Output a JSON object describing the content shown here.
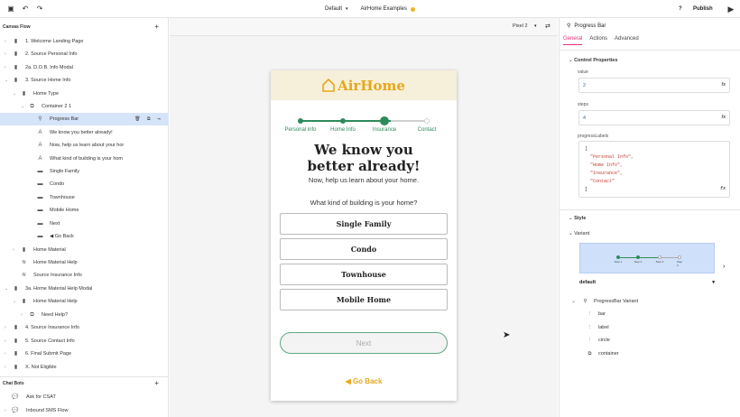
{
  "topbar": {
    "env": "Default",
    "project": "AirHome Examples",
    "help": "?",
    "publish": "Publish"
  },
  "left": {
    "canvas_title": "Canvas Flow",
    "canvas_items": [
      {
        "label": "1. Welcome Landing Page"
      },
      {
        "label": "2. Source Personal Info"
      },
      {
        "label": "2a. D.O.B. Info Modal"
      },
      {
        "label": "3. Source Home Info"
      },
      {
        "label": "Home Type"
      },
      {
        "label": "Container 2 1"
      },
      {
        "label": "Progress Bar"
      },
      {
        "label": "We know you better already!"
      },
      {
        "label": "Now, help us learn about your hor"
      },
      {
        "label": "What kind of building is your hom"
      },
      {
        "label": "Single Family"
      },
      {
        "label": "Condo"
      },
      {
        "label": "Townhouse"
      },
      {
        "label": "Mobile Home"
      },
      {
        "label": "Next"
      },
      {
        "label": "Go Back"
      },
      {
        "label": "Home Material"
      },
      {
        "label": "Home Material Help"
      },
      {
        "label": "Source Insurance Info"
      },
      {
        "label": "3a. Home Material Help Modal"
      },
      {
        "label": "Home Material Help"
      },
      {
        "label": "Need Help?"
      },
      {
        "label": "4. Source Insurance Info"
      },
      {
        "label": "5. Source Contact Info"
      },
      {
        "label": "6. Final Submit Page"
      },
      {
        "label": "X. Not Eligible"
      }
    ],
    "chatbots_title": "Chat Bots",
    "chatbots": [
      {
        "label": "Ask for CSAT"
      },
      {
        "label": "Inbound SMS Flow"
      }
    ]
  },
  "center": {
    "device": "Pixel 2",
    "brand": "AirHome",
    "steps": [
      "Personal info",
      "Home Info",
      "Insurance",
      "Contact"
    ],
    "progress": {
      "steps": 4,
      "value": 2
    },
    "heading": "We know you better already!",
    "subheading": "Now, help us learn about your home.",
    "question": "What kind of building is your home?",
    "options": [
      "Single Family",
      "Condo",
      "Townhouse",
      "Mobile Home"
    ],
    "next": "Next",
    "goback": "Go Back"
  },
  "right": {
    "title": "Progress Bar",
    "tabs": [
      "General",
      "Actions",
      "Advanced"
    ],
    "control_properties": "Control Properties",
    "value_label": "value",
    "value": "2",
    "steps_label": "steps",
    "steps": "4",
    "progresslabels_label": "progressLabels",
    "progresslabels_lines": [
      "[",
      "  \"Personal Info\",",
      "  \"Home Info\",",
      "  \"Insurance\",",
      "  \"Contact\"",
      "]"
    ],
    "fx": "fx",
    "style": "Style",
    "variant": "Variant",
    "variant_steps": [
      "Step 1",
      "Step 2",
      "Step 3",
      "Step 4"
    ],
    "variant_select": "default",
    "progressbar_variant": "ProgressBar Variant",
    "parts": [
      "bar",
      "label",
      "circle",
      "container"
    ]
  },
  "colors": {
    "accent": "#e6337a",
    "green": "#2e8a5c",
    "brand": "#e6a81a",
    "selection": "#d6e4fa"
  }
}
